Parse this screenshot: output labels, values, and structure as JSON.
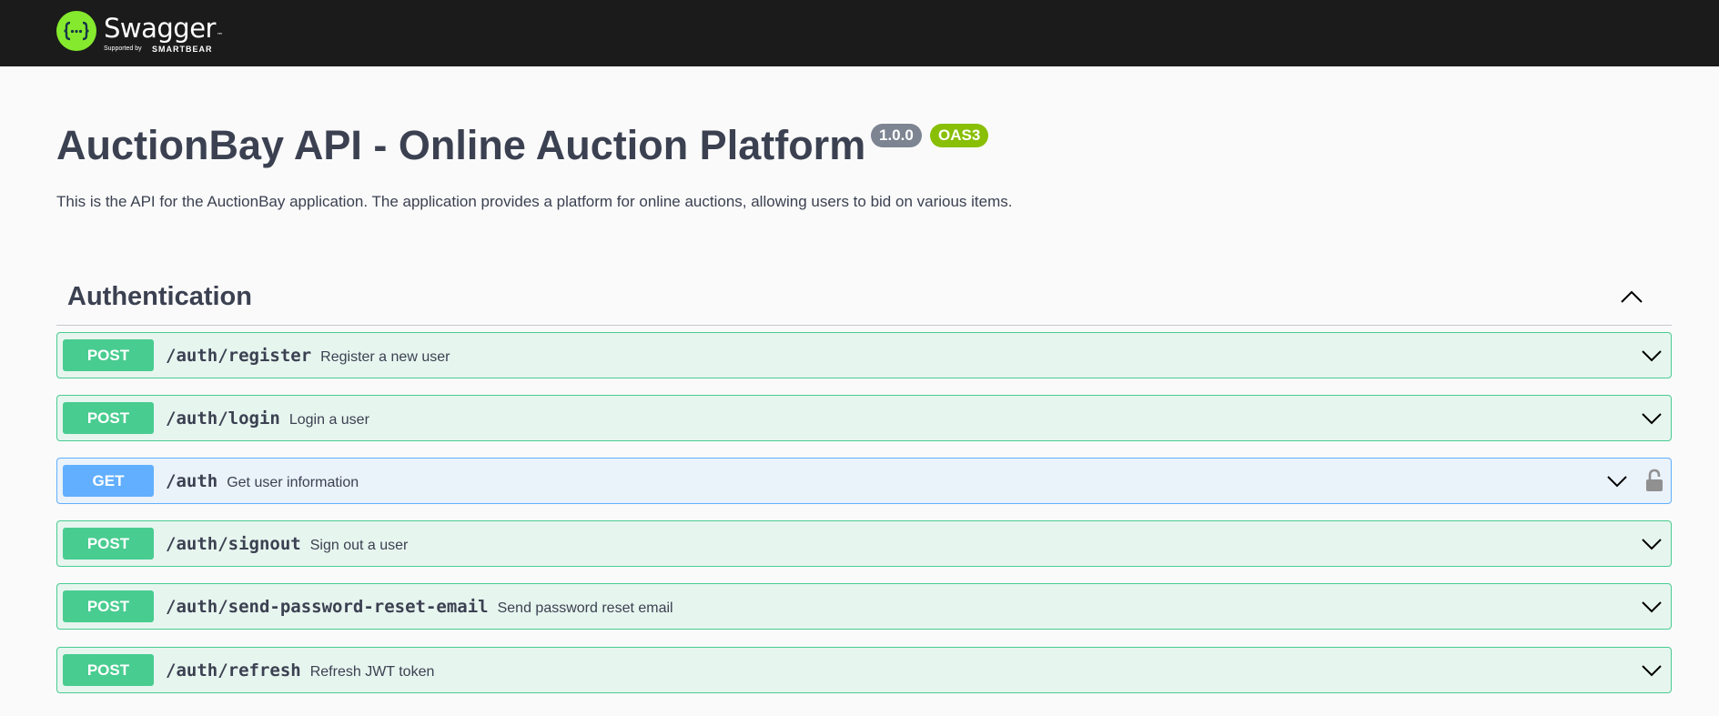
{
  "topbar": {
    "logo_name": "Swagger",
    "logo_tm": "™",
    "logo_supported": "Supported by",
    "logo_brand": "SMARTBEAR"
  },
  "info": {
    "title": "AuctionBay API - Online Auction Platform",
    "version": "1.0.0",
    "oas": "OAS3",
    "description": "This is the API for the AuctionBay application. The application provides a platform for online auctions, allowing users to bid on various items."
  },
  "section": {
    "title": "Authentication",
    "expanded": true
  },
  "operations": [
    {
      "method": "POST",
      "path": "/auth/register",
      "summary": "Register a new user"
    },
    {
      "method": "POST",
      "path": "/auth/login",
      "summary": "Login a user"
    },
    {
      "method": "GET",
      "path": "/auth",
      "summary": "Get user information",
      "secured": true
    },
    {
      "method": "POST",
      "path": "/auth/signout",
      "summary": "Sign out a user"
    },
    {
      "method": "POST",
      "path": "/auth/send-password-reset-email",
      "summary": "Send password reset email"
    },
    {
      "method": "POST",
      "path": "/auth/refresh",
      "summary": "Refresh JWT token"
    }
  ],
  "icons": {
    "logo": "swagger-braces-icon",
    "section_toggle": "chevron-up-icon",
    "expand": "chevron-down-icon",
    "auth": "lock-icon"
  },
  "colors": {
    "topbar": "#1b1b1b",
    "logo": "#85ea2d",
    "post": "#49cc90",
    "get": "#61affe",
    "version_badge": "#7d8492",
    "oas_badge": "#89bf04"
  }
}
